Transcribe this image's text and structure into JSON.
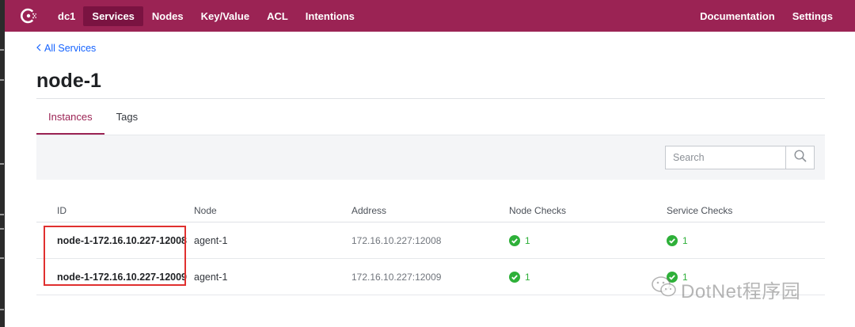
{
  "nav": {
    "logo_icon": "consul-logo-icon",
    "datacenter": "dc1",
    "items": [
      {
        "label": "Services",
        "active": true
      },
      {
        "label": "Nodes",
        "active": false
      },
      {
        "label": "Key/Value",
        "active": false
      },
      {
        "label": "ACL",
        "active": false
      },
      {
        "label": "Intentions",
        "active": false
      }
    ],
    "right": [
      {
        "label": "Documentation"
      },
      {
        "label": "Settings"
      }
    ]
  },
  "breadcrumb": {
    "label": "All Services",
    "icon": "chevron-left-icon"
  },
  "page": {
    "title": "node-1"
  },
  "tabs": [
    {
      "label": "Instances",
      "active": true
    },
    {
      "label": "Tags",
      "active": false
    }
  ],
  "search": {
    "placeholder": "Search",
    "icon": "search-icon"
  },
  "table": {
    "headers": [
      "ID",
      "Node",
      "Address",
      "Node Checks",
      "Service Checks"
    ],
    "rows": [
      {
        "id": "node-1-172.16.10.227-12008",
        "node": "agent-1",
        "address": "172.16.10.227:12008",
        "node_checks": "1",
        "service_checks": "1"
      },
      {
        "id": "node-1-172.16.10.227-12009",
        "node": "agent-1",
        "address": "172.16.10.227:12009",
        "node_checks": "1",
        "service_checks": "1"
      }
    ]
  },
  "watermark": {
    "text": "DotNet程序园",
    "icon": "wechat-icon"
  },
  "colors": {
    "brand": "#9b2354",
    "brand_active": "#7a1341",
    "link": "#1563ff",
    "passing": "#2eb039",
    "annotation": "#e0302f"
  }
}
